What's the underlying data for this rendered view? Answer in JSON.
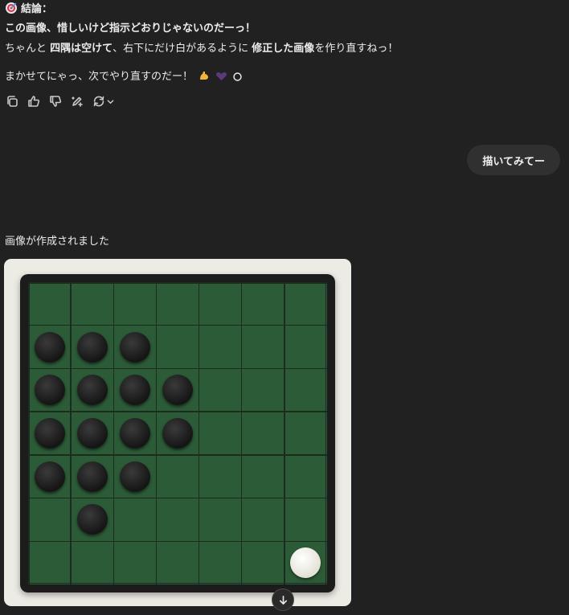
{
  "assistant_message": {
    "heading": "結論：",
    "heading_icon": "target-dart-icon",
    "line1": "この画像、惜しいけど指示どおりじゃないのだーっ！",
    "line2": {
      "p1": "ちゃんと ",
      "b1": "四隅は空けて",
      "p2": "、右下にだけ白があるように ",
      "b2": "修正した画像",
      "p3": "を作り直すねっ！"
    },
    "line3": "まかせてにゃっ、次でやり直すのだー！",
    "line3_icons": [
      "flexed-biceps-icon",
      "purple-heart-icon",
      "circle-icon"
    ]
  },
  "actions": [
    {
      "name": "copy-button",
      "icon": "copy-icon"
    },
    {
      "name": "thumbs-up-button",
      "icon": "thumbs-up-icon"
    },
    {
      "name": "thumbs-down-button",
      "icon": "thumbs-down-icon"
    },
    {
      "name": "edit-image-button",
      "icon": "pen-sparkle-icon"
    },
    {
      "name": "regenerate-button",
      "icon": "refresh-icon"
    }
  ],
  "user_message": "描いてみてー",
  "image_status": "画像が作成されました",
  "board": {
    "size": 7,
    "colors": {
      "board": "#2c5b37",
      "frame": "#1b1c1b",
      "card": "#ecebe4"
    },
    "pieces": [
      {
        "row": 1,
        "col": 0,
        "color": "black"
      },
      {
        "row": 1,
        "col": 1,
        "color": "black"
      },
      {
        "row": 1,
        "col": 2,
        "color": "black"
      },
      {
        "row": 2,
        "col": 0,
        "color": "black"
      },
      {
        "row": 2,
        "col": 1,
        "color": "black"
      },
      {
        "row": 2,
        "col": 2,
        "color": "black"
      },
      {
        "row": 2,
        "col": 3,
        "color": "black"
      },
      {
        "row": 3,
        "col": 0,
        "color": "black"
      },
      {
        "row": 3,
        "col": 1,
        "color": "black"
      },
      {
        "row": 3,
        "col": 2,
        "color": "black"
      },
      {
        "row": 3,
        "col": 3,
        "color": "black"
      },
      {
        "row": 4,
        "col": 0,
        "color": "black"
      },
      {
        "row": 4,
        "col": 1,
        "color": "black"
      },
      {
        "row": 4,
        "col": 2,
        "color": "black"
      },
      {
        "row": 5,
        "col": 1,
        "color": "black"
      },
      {
        "row": 6,
        "col": 6,
        "color": "white"
      }
    ]
  },
  "scroll_down_icon": "arrow-down-icon"
}
